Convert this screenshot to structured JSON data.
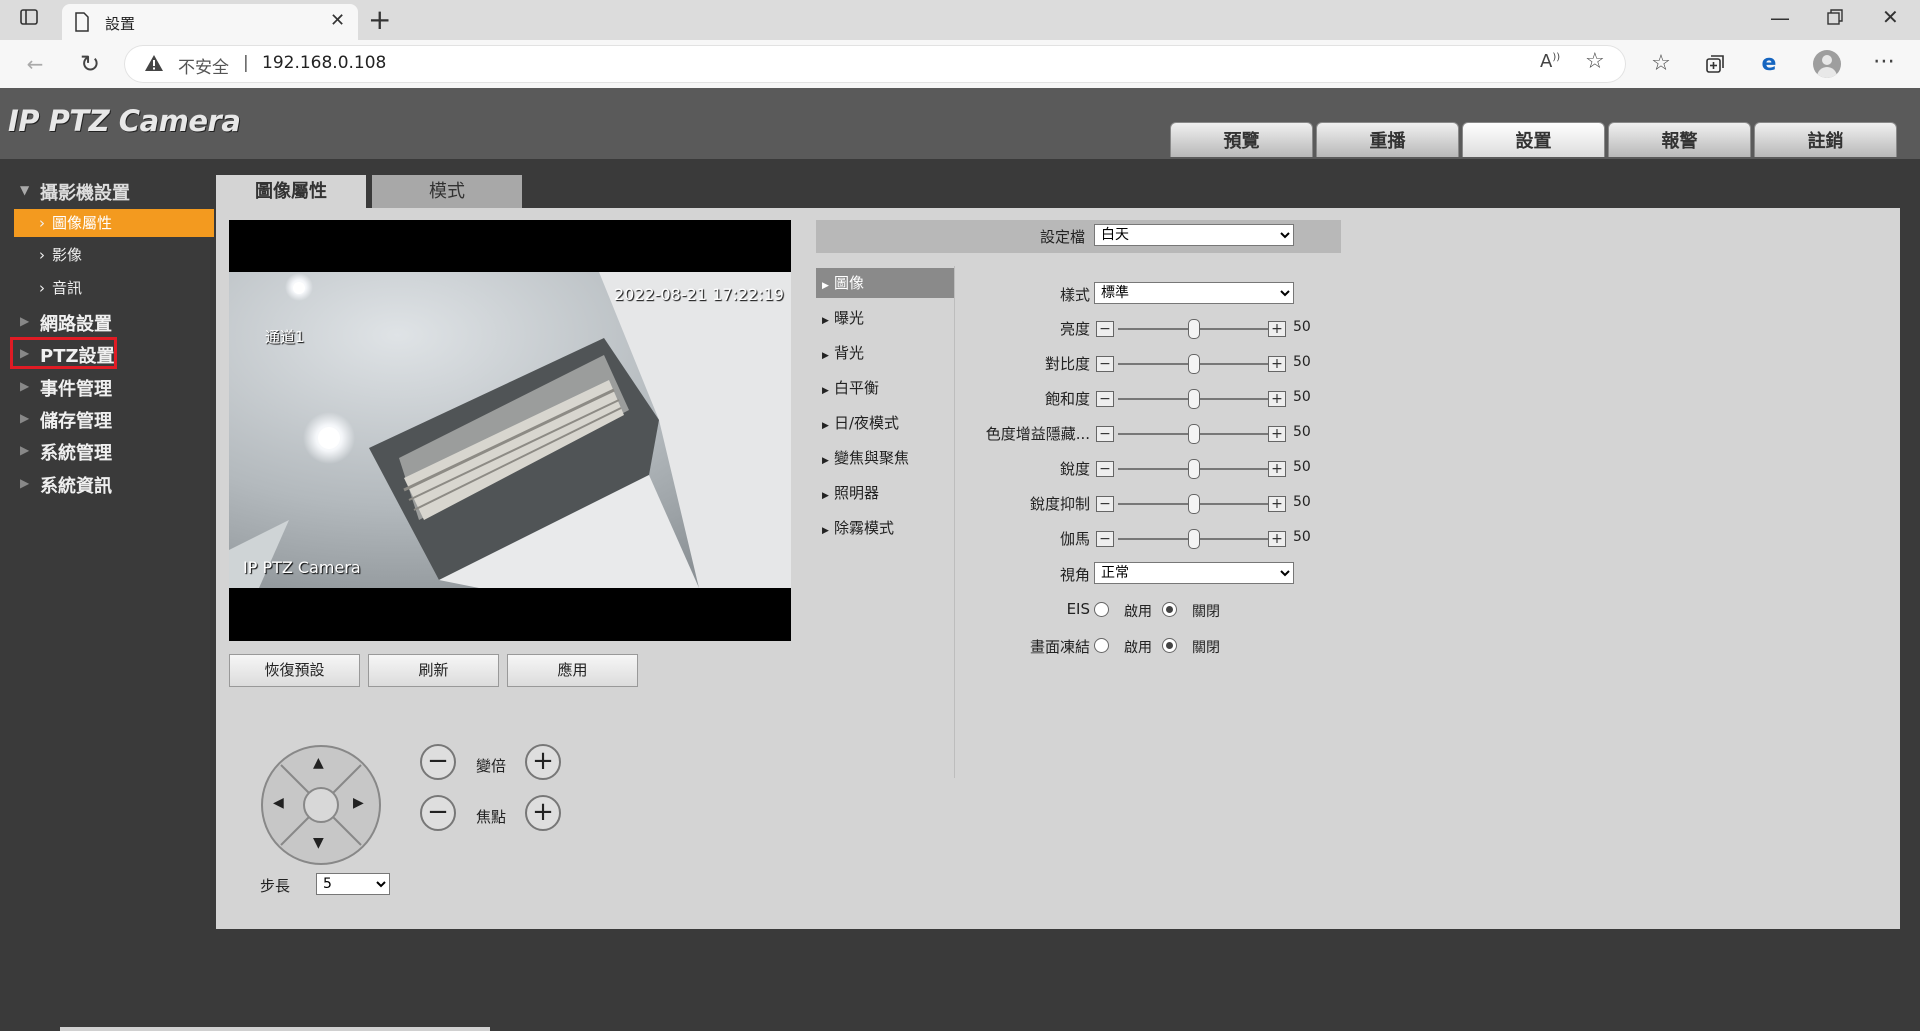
{
  "browser": {
    "tab_title": "設置",
    "new_tab_glyph": "+",
    "security_label": "不安全",
    "url": "192.168.0.108",
    "icons": [
      "sidebar-icon",
      "page-icon",
      "close-icon",
      "new-tab-icon",
      "minimize-icon",
      "restore-icon",
      "window-close-icon",
      "back-icon",
      "refresh-icon",
      "warning-icon",
      "read-aloud-icon",
      "add-favorite-icon",
      "favorites-icon",
      "collections-icon",
      "ie-mode-icon",
      "profile-icon",
      "more-icon"
    ]
  },
  "app": {
    "logo": "IP PTZ Camera",
    "nav": [
      {
        "label": "預覽",
        "active": false
      },
      {
        "label": "重播",
        "active": false
      },
      {
        "label": "設置",
        "active": true
      },
      {
        "label": "報警",
        "active": false
      },
      {
        "label": "註銷",
        "active": false
      }
    ]
  },
  "sidebar": {
    "camera_settings": "攝影機設置",
    "sub_items": [
      {
        "label": "圖像屬性",
        "active": true
      },
      {
        "label": "影像",
        "active": false
      },
      {
        "label": "音訊",
        "active": false
      }
    ],
    "sections": [
      "網路設置",
      "PTZ設置",
      "事件管理",
      "儲存管理",
      "系統管理",
      "系統資訊"
    ]
  },
  "content_tabs": [
    {
      "label": "圖像屬性",
      "active": true
    },
    {
      "label": "模式",
      "active": false
    }
  ],
  "video": {
    "timestamp": "2022-08-21 17:22:19",
    "channel": "通道1",
    "overlay_name": "IP PTZ Camera"
  },
  "buttons": {
    "restore_default": "恢復預設",
    "refresh": "刷新",
    "apply": "應用"
  },
  "ptz": {
    "zoom_label": "變倍",
    "focus_label": "焦點",
    "step_label": "步長",
    "step_value": "5"
  },
  "settings": {
    "profile_label": "設定檔",
    "profile_value": "白天",
    "submenu": [
      {
        "label": "圖像",
        "active": true
      },
      {
        "label": "曝光",
        "active": false
      },
      {
        "label": "背光",
        "active": false
      },
      {
        "label": "白平衡",
        "active": false
      },
      {
        "label": "日/夜模式",
        "active": false
      },
      {
        "label": "變焦與聚焦",
        "active": false
      },
      {
        "label": "照明器",
        "active": false
      },
      {
        "label": "除霧模式",
        "active": false
      }
    ],
    "style_label": "樣式",
    "style_value": "標準",
    "sliders": [
      {
        "label": "亮度",
        "value": 50
      },
      {
        "label": "對比度",
        "value": 50
      },
      {
        "label": "飽和度",
        "value": 50
      },
      {
        "label": "色度增益隱藏...",
        "value": 50
      },
      {
        "label": "銳度",
        "value": 50
      },
      {
        "label": "銳度抑制",
        "value": 50
      },
      {
        "label": "伽馬",
        "value": 50
      }
    ],
    "view_label": "視角",
    "view_value": "正常",
    "eis_label": "EIS",
    "freeze_label": "畫面凍結",
    "enable_label": "啟用",
    "disable_label": "關閉",
    "eis_enabled": false,
    "freeze_enabled": false
  }
}
